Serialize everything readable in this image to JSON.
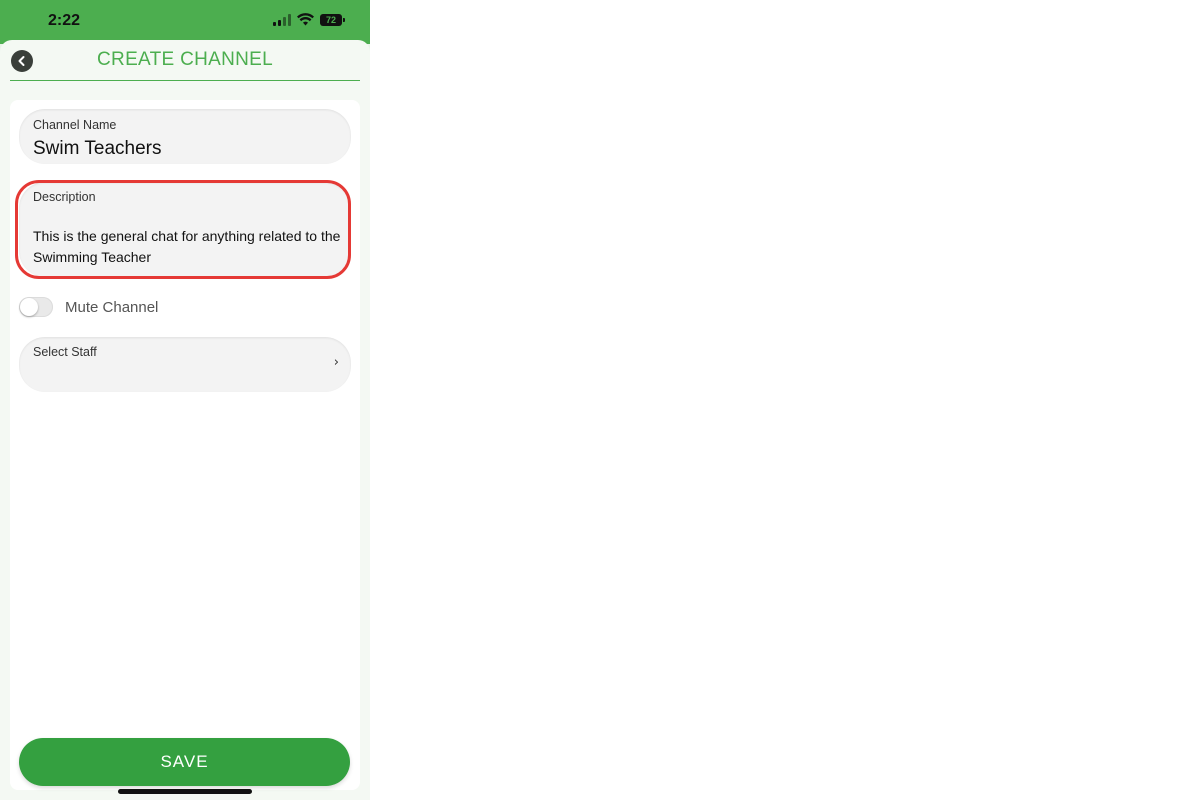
{
  "status_bar": {
    "time": "2:22",
    "battery": "72"
  },
  "header": {
    "title": "CREATE CHANNEL"
  },
  "form": {
    "channel_name_label": "Channel Name",
    "channel_name_value": "Swim Teachers",
    "description_label": "Description",
    "description_value": "This is the general chat for anything related to the Swimming Teacher",
    "mute_label": "Mute Channel",
    "mute_enabled": false,
    "select_staff_label": "Select Staff",
    "select_staff_chevron": "›"
  },
  "actions": {
    "save_label": "SAVE"
  },
  "colors": {
    "accent": "#4cae4f",
    "save": "#34a040",
    "highlight": "#e53935"
  },
  "icons": {
    "back": "back-arrow-icon",
    "wifi": "wifi-icon",
    "signal": "signal-icon",
    "battery": "battery-icon",
    "chevron": "chevron-right-icon"
  }
}
